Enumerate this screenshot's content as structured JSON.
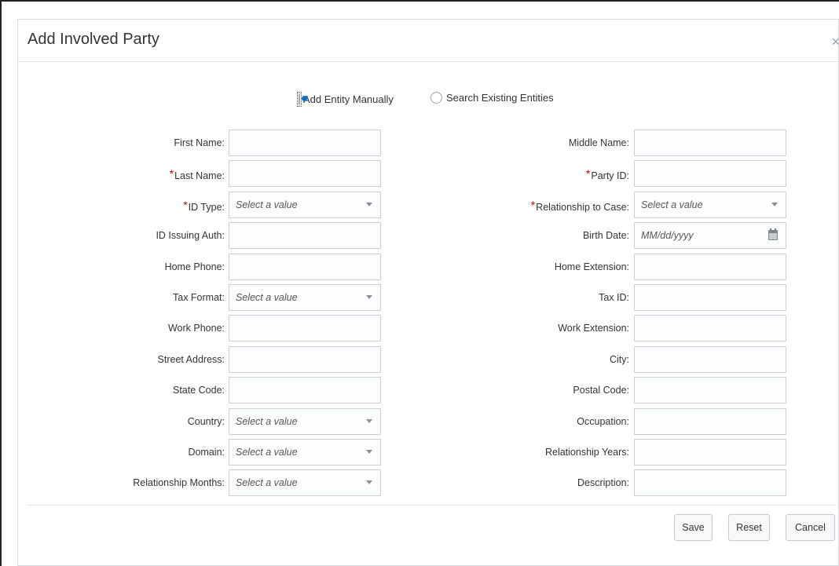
{
  "dialog": {
    "title": "Add Involved Party",
    "close_glyph": "×"
  },
  "mode": {
    "options": [
      {
        "label": "Add Entity Manually",
        "checked": true
      },
      {
        "label": "Search Existing Entities",
        "checked": false
      }
    ]
  },
  "form": {
    "required_marker": "*",
    "left": [
      {
        "label": "First Name:",
        "required": false,
        "kind": "text",
        "value": ""
      },
      {
        "label": "Last Name:",
        "required": true,
        "kind": "text",
        "value": ""
      },
      {
        "label": "ID Type:",
        "required": true,
        "kind": "select",
        "placeholder": "Select a value"
      },
      {
        "label": "ID Issuing Auth:",
        "required": false,
        "kind": "text",
        "value": ""
      },
      {
        "label": "Home Phone:",
        "required": false,
        "kind": "text",
        "value": ""
      },
      {
        "label": "Tax Format:",
        "required": false,
        "kind": "select",
        "placeholder": "Select a value"
      },
      {
        "label": "Work Phone:",
        "required": false,
        "kind": "text",
        "value": ""
      },
      {
        "label": "Street Address:",
        "required": false,
        "kind": "text",
        "value": ""
      },
      {
        "label": "State Code:",
        "required": false,
        "kind": "text",
        "value": ""
      },
      {
        "label": "Country:",
        "required": false,
        "kind": "select",
        "placeholder": "Select a value"
      },
      {
        "label": "Domain:",
        "required": false,
        "kind": "select",
        "placeholder": "Select a value"
      },
      {
        "label": "Relationship Months:",
        "required": false,
        "kind": "select",
        "placeholder": "Select a value"
      }
    ],
    "right": [
      {
        "label": "Middle Name:",
        "required": false,
        "kind": "text",
        "value": ""
      },
      {
        "label": "Party ID:",
        "required": true,
        "kind": "text",
        "value": ""
      },
      {
        "label": "Relationship to Case:",
        "required": true,
        "kind": "select",
        "placeholder": "Select a value"
      },
      {
        "label": "Birth Date:",
        "required": false,
        "kind": "date",
        "placeholder": "MM/dd/yyyy"
      },
      {
        "label": "Home Extension:",
        "required": false,
        "kind": "text",
        "value": ""
      },
      {
        "label": "Tax ID:",
        "required": false,
        "kind": "text",
        "value": ""
      },
      {
        "label": "Work Extension:",
        "required": false,
        "kind": "text",
        "value": ""
      },
      {
        "label": "City:",
        "required": false,
        "kind": "text",
        "value": ""
      },
      {
        "label": "Postal Code:",
        "required": false,
        "kind": "text",
        "value": ""
      },
      {
        "label": "Occupation:",
        "required": false,
        "kind": "text",
        "value": ""
      },
      {
        "label": "Relationship Years:",
        "required": false,
        "kind": "text",
        "value": ""
      },
      {
        "label": "Description:",
        "required": false,
        "kind": "text",
        "value": ""
      }
    ]
  },
  "buttons": {
    "save": "Save",
    "reset": "Reset",
    "cancel": "Cancel"
  },
  "icons": {
    "caret": "chevron-down-icon",
    "calendar": "calendar-icon",
    "close": "close-icon"
  },
  "colors": {
    "accent": "#0572ce",
    "required": "#d40000",
    "field_border": "#c9cfd6"
  }
}
